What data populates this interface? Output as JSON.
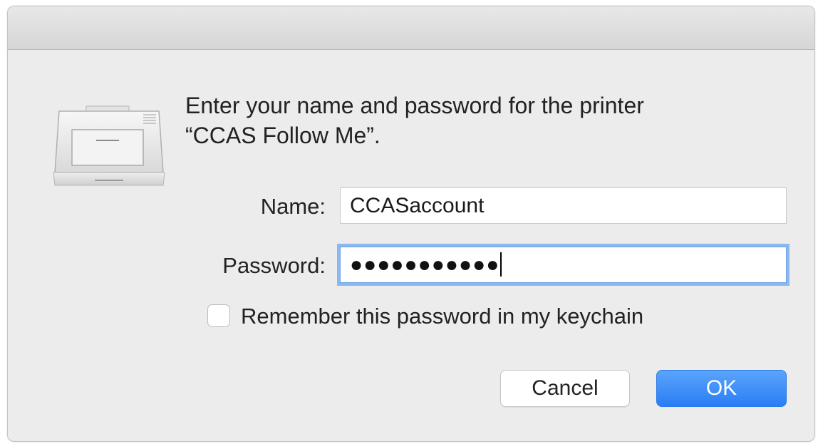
{
  "dialog": {
    "icon": "printer-icon",
    "message_line1": "Enter your name and password for the printer",
    "message_line2": "“CCAS Follow Me”."
  },
  "form": {
    "name_label": "Name:",
    "name_value": "CCASaccount",
    "password_label": "Password:",
    "password_masked": "●●●●●●●●●●●",
    "remember_label": "Remember this password in my keychain",
    "remember_checked": false
  },
  "buttons": {
    "cancel_label": "Cancel",
    "ok_label": "OK"
  },
  "colors": {
    "accent": "#2a7ef5",
    "focus_ring": "#8bb8ef",
    "dialog_bg": "#ececec"
  }
}
